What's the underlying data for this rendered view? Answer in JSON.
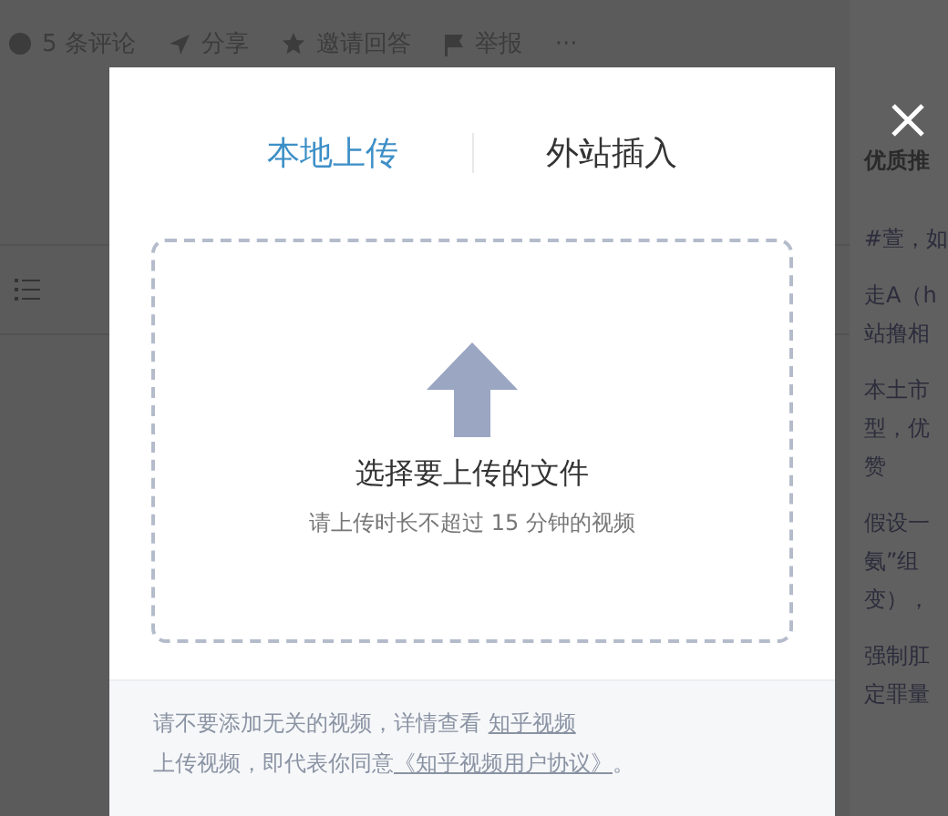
{
  "action_bar": [
    {
      "kind": "comment",
      "label": "5 条评论"
    },
    {
      "kind": "share",
      "label": "分享"
    },
    {
      "kind": "invite",
      "label": "邀请回答"
    },
    {
      "kind": "report",
      "label": "举报"
    },
    {
      "kind": "more",
      "label": "···"
    }
  ],
  "sidebar": {
    "title": "优质推",
    "items": [
      [
        "#萱，如"
      ],
      [
        "走A（h",
        "站撸相"
      ],
      [
        "本土市",
        "型，优",
        "赞"
      ],
      [
        "假设一",
        "氨”组",
        "变），"
      ],
      [
        "强制肛",
        "定罪量"
      ]
    ]
  },
  "dialog": {
    "tabs": [
      {
        "label": "本地上传",
        "selected": true
      },
      {
        "label": "外站插入",
        "selected": false
      }
    ],
    "dropzone": {
      "title": "选择要上传的文件",
      "hint": "请上传时长不超过 15 分钟的视频"
    },
    "notice": {
      "line1": "请不要添加无关的视频，详情查看 ",
      "link1": "知乎视频",
      "line2": "上传视频，即代表你同意",
      "link2": "《知乎视频用户协议》",
      "end": "。"
    }
  }
}
